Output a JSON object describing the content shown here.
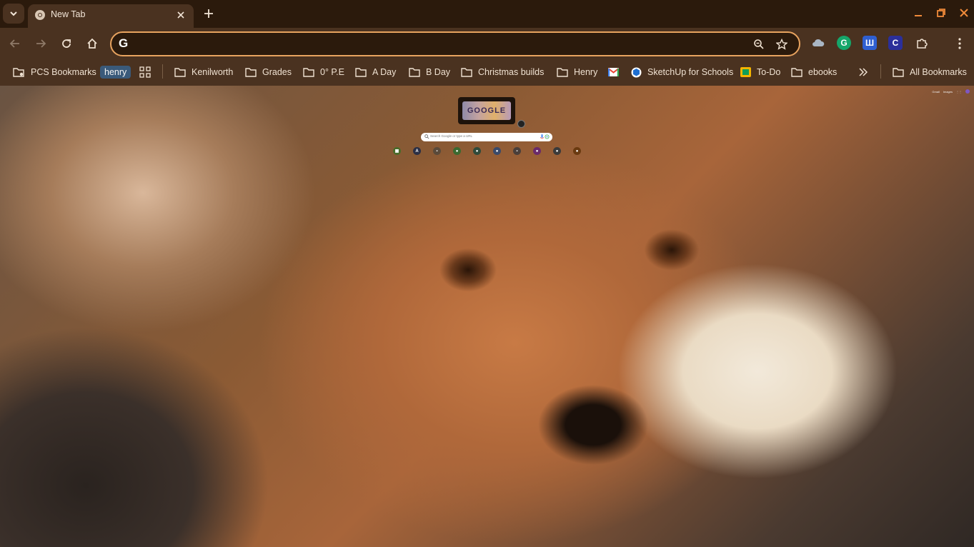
{
  "tab": {
    "title": "New Tab"
  },
  "omnibox": {
    "value": "",
    "placeholder": ""
  },
  "bookmarks": {
    "items": [
      {
        "label": "PCS Bookmarks",
        "icon": "managed-folder-icon"
      },
      {
        "label": "henry",
        "icon": "none"
      },
      {
        "label": "",
        "icon": "apps-grid-icon"
      },
      {
        "label": "Kenilworth",
        "icon": "folder-icon"
      },
      {
        "label": "Grades",
        "icon": "folder-icon"
      },
      {
        "label": "0° P.E",
        "icon": "folder-icon"
      },
      {
        "label": "A Day",
        "icon": "folder-icon"
      },
      {
        "label": "B Day",
        "icon": "folder-icon"
      },
      {
        "label": "Christmas builds",
        "icon": "folder-icon"
      },
      {
        "label": "Henry",
        "icon": "folder-icon"
      },
      {
        "label": "",
        "icon": "gmail-icon"
      },
      {
        "label": "SketchUp for Schools",
        "icon": "sketchup-icon"
      },
      {
        "label": "To-Do",
        "icon": "todo-icon"
      },
      {
        "label": "ebooks",
        "icon": "folder-icon"
      }
    ],
    "all_bookmarks": "All Bookmarks"
  },
  "ntp": {
    "doodle_text": "GOOGLE",
    "search_placeholder": "Search Google or type a URL",
    "corner_links": [
      "Gmail",
      "Images"
    ]
  },
  "colors": {
    "frame": "#2b1a0c",
    "toolbar": "#4a3220",
    "omnibox_border": "#e8a35f",
    "accent": "#e8a35f"
  }
}
